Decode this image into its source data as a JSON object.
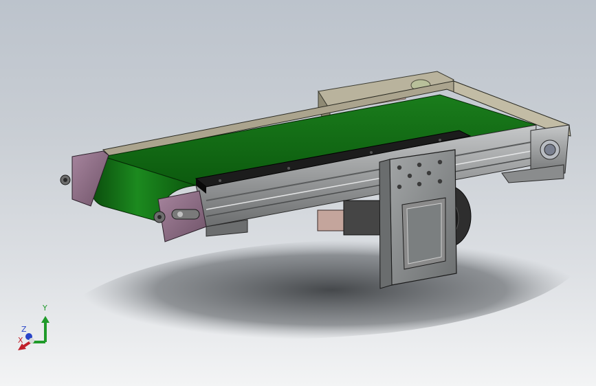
{
  "viewport": {
    "background_top": "#bcc3cc",
    "background_bottom": "#f3f4f5"
  },
  "model": {
    "belt_color": "#0f6a12",
    "frame_color": "#9a9d9e",
    "end_plate_color": "#8f6f86",
    "guide_rail_color": "#1e1e1e",
    "bracket_color": "#8c8f90",
    "motor_color": "#3a3a3a",
    "tray_color": "#aaa592"
  },
  "triad": {
    "x_label": "X",
    "y_label": "Y",
    "z_label": "Z",
    "x_color": "#c0202a",
    "y_color": "#1f9a2a",
    "z_color": "#2a45c8"
  }
}
